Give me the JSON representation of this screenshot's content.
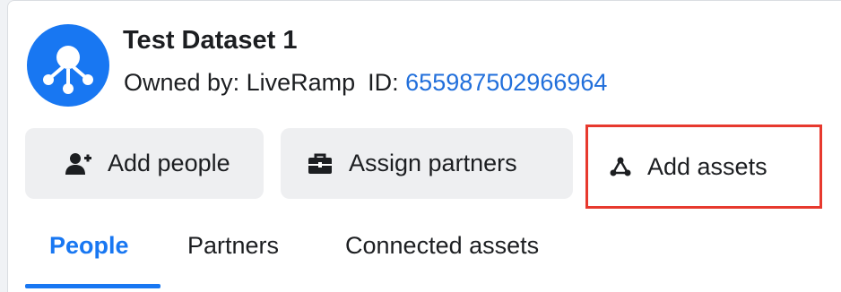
{
  "dataset": {
    "title": "Test Dataset 1",
    "owner_label": "Owned by: LiveRamp",
    "id_label": "ID:",
    "id_value": "655987502966964",
    "avatar_icon": "dataset-network-icon"
  },
  "actions": [
    {
      "label": "Add people",
      "icon": "add-person-icon"
    },
    {
      "label": "Assign partners",
      "icon": "briefcase-icon"
    },
    {
      "label": "Add assets",
      "icon": "asset-nodes-icon",
      "highlighted": true
    }
  ],
  "tabs": [
    {
      "label": "People",
      "active": true
    },
    {
      "label": "Partners",
      "active": false
    },
    {
      "label": "Connected assets",
      "active": false
    }
  ],
  "colors": {
    "brand": "#1877f2",
    "link": "#216fdb",
    "highlight_border": "#e7392e",
    "button_bg": "#eeeff1",
    "text": "#1c1e21"
  }
}
